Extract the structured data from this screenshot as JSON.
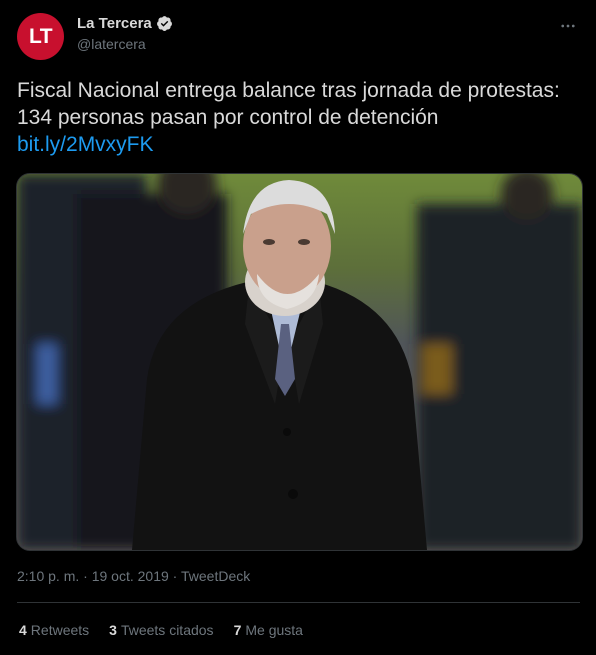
{
  "author": {
    "avatar_text": "LT",
    "avatar_color": "#c8102e",
    "display_name": "La Tercera",
    "handle": "@latercera",
    "verified": true
  },
  "menu_icon": "more-horizontal-icon",
  "tweet": {
    "text": "Fiscal Nacional entrega balance tras jornada de protestas: 134 personas pasan por control de detención",
    "link": "bit.ly/2MvxyFK"
  },
  "media": {
    "kind": "photo"
  },
  "meta": {
    "time": "2:10 p. m.",
    "date": "19 oct. 2019",
    "source": "TweetDeck",
    "separator": "·"
  },
  "stats": {
    "retweets_count": "4",
    "retweets_label": "Retweets",
    "quotes_count": "3",
    "quotes_label": "Tweets citados",
    "likes_count": "7",
    "likes_label": "Me gusta"
  },
  "colors": {
    "background": "#000000",
    "link": "#1d9bf0",
    "muted": "#6e767d",
    "verified": "#d9d9d9"
  }
}
